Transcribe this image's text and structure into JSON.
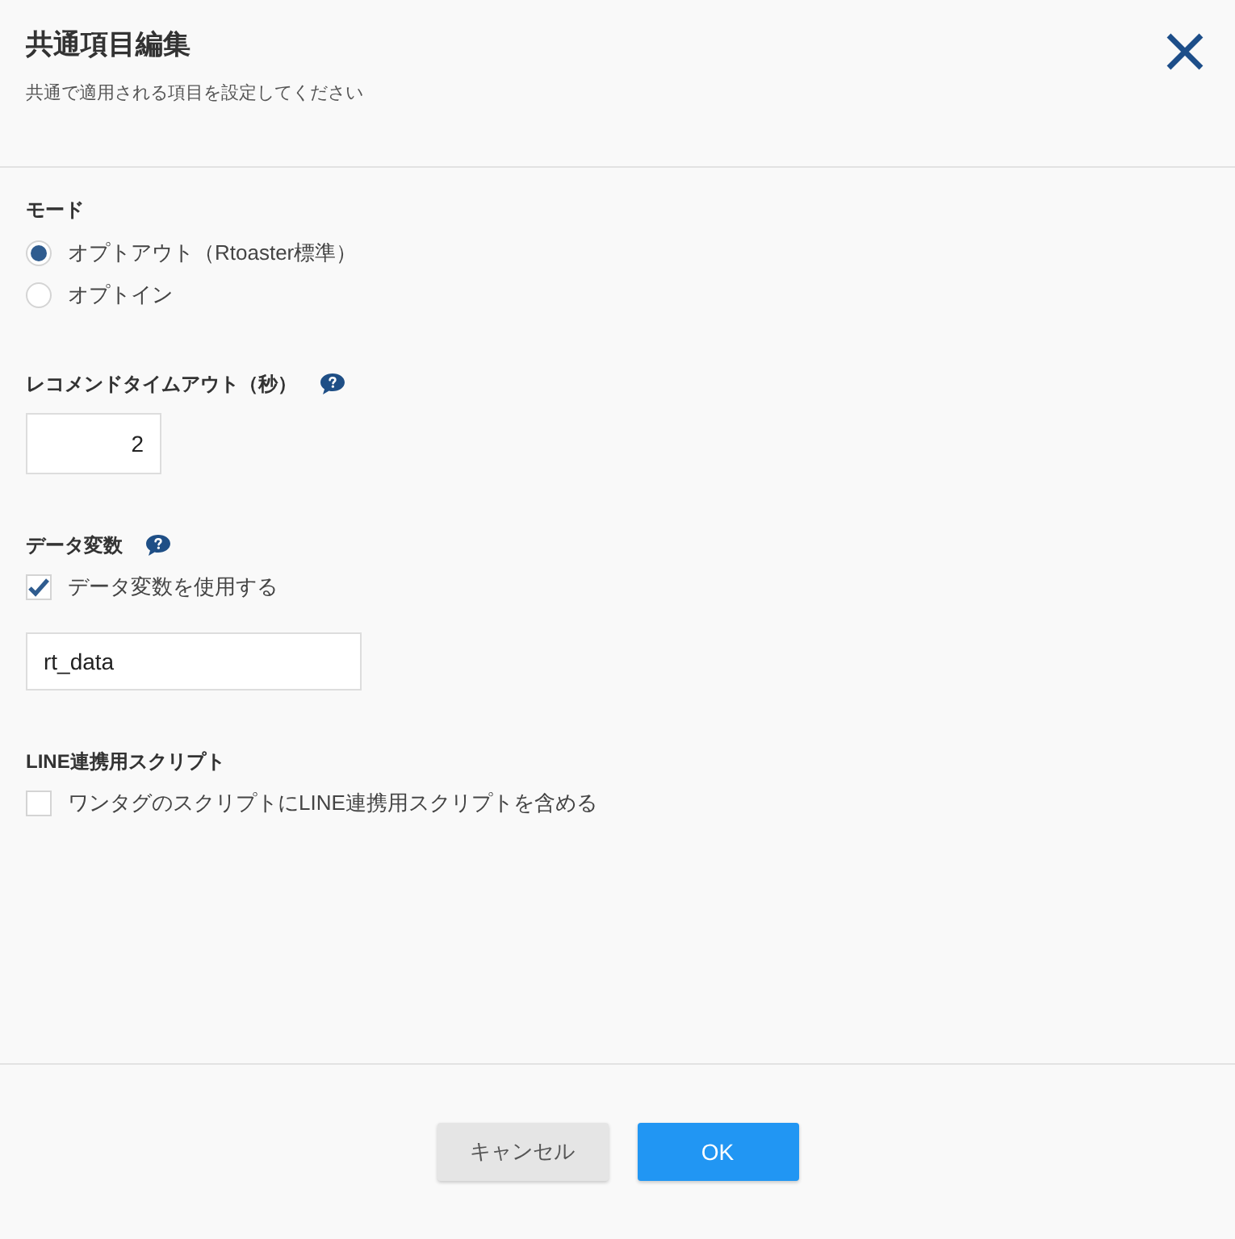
{
  "dialog": {
    "title": "共通項目編集",
    "subtitle": "共通で適用される項目を設定してください"
  },
  "sections": [
    {
      "kind": "radio",
      "label": "モード",
      "help": false,
      "options": [
        {
          "label": "オプトアウト（Rtoaster標準）",
          "selected": true
        },
        {
          "label": "オプトイン",
          "selected": false
        }
      ]
    },
    {
      "kind": "number",
      "label": "レコメンドタイムアウト（秒）",
      "help": true,
      "value": "2"
    },
    {
      "kind": "checkbox-input",
      "label": "データ変数",
      "help": true,
      "checkbox": {
        "label": "データ変数を使用する",
        "checked": true
      },
      "value": "rt_data"
    },
    {
      "kind": "checkbox",
      "label": "LINE連携用スクリプト",
      "help": false,
      "checkbox": {
        "label": "ワンタグのスクリプトにLINE連携用スクリプトを含める",
        "checked": false
      }
    }
  ],
  "buttons": [
    {
      "label": "キャンセル",
      "kind": "secondary"
    },
    {
      "label": "OK",
      "kind": "primary"
    }
  ]
}
